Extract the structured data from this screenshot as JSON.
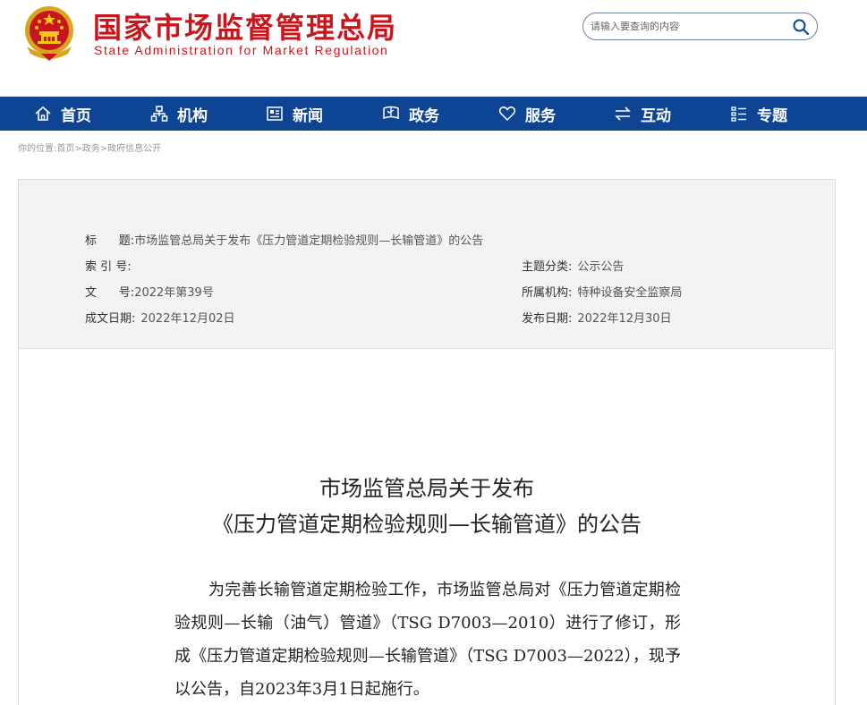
{
  "header": {
    "title_cn": "国家市场监督管理总局",
    "title_en": "State Administration for Market Regulation",
    "search_placeholder": "请输入要查询的内容"
  },
  "nav": {
    "items": [
      {
        "label": "首页",
        "icon": "home-icon"
      },
      {
        "label": "机构",
        "icon": "org-icon"
      },
      {
        "label": "新闻",
        "icon": "news-icon"
      },
      {
        "label": "政务",
        "icon": "affairs-icon"
      },
      {
        "label": "服务",
        "icon": "heart-icon"
      },
      {
        "label": "互动",
        "icon": "exchange-icon"
      },
      {
        "label": "专题",
        "icon": "topic-icon"
      }
    ]
  },
  "breadcrumb": {
    "prefix": "你的位置:",
    "items": [
      "首页",
      "政务",
      "政府信息公开"
    ],
    "sep": ">"
  },
  "meta": {
    "title_key": "标      题:",
    "title_val": "市场监管总局关于发布《压力管道定期检验规则—长输管道》的公告",
    "index_key": "索 引 号:",
    "index_val": "",
    "category_key": "主题分类:",
    "category_val": "公示公告",
    "docno_key": "文      号:",
    "docno_val": "2022年第39号",
    "org_key": "所属机构:",
    "org_val": "特种设备安全监察局",
    "created_key": "成文日期:",
    "created_val": "2022年12月02日",
    "published_key": "发布日期:",
    "published_val": "2022年12月30日"
  },
  "document": {
    "title_line1": "市场监管总局关于发布",
    "title_line2": "《压力管道定期检验规则—长输管道》的公告",
    "body": "为完善长输管道定期检验工作，市场监管总局对《压力管道定期检验规则—长输（油气）管道》（TSG D7003—2010）进行了修订，形成《压力管道定期检验规则—长输管道》（TSG D7003—2022），现予以公告，自2023年3月1日起施行。"
  },
  "colors": {
    "brand_red": "#c8161d",
    "nav_blue": "#0d4494",
    "meta_bg": "#f3f3f3"
  }
}
